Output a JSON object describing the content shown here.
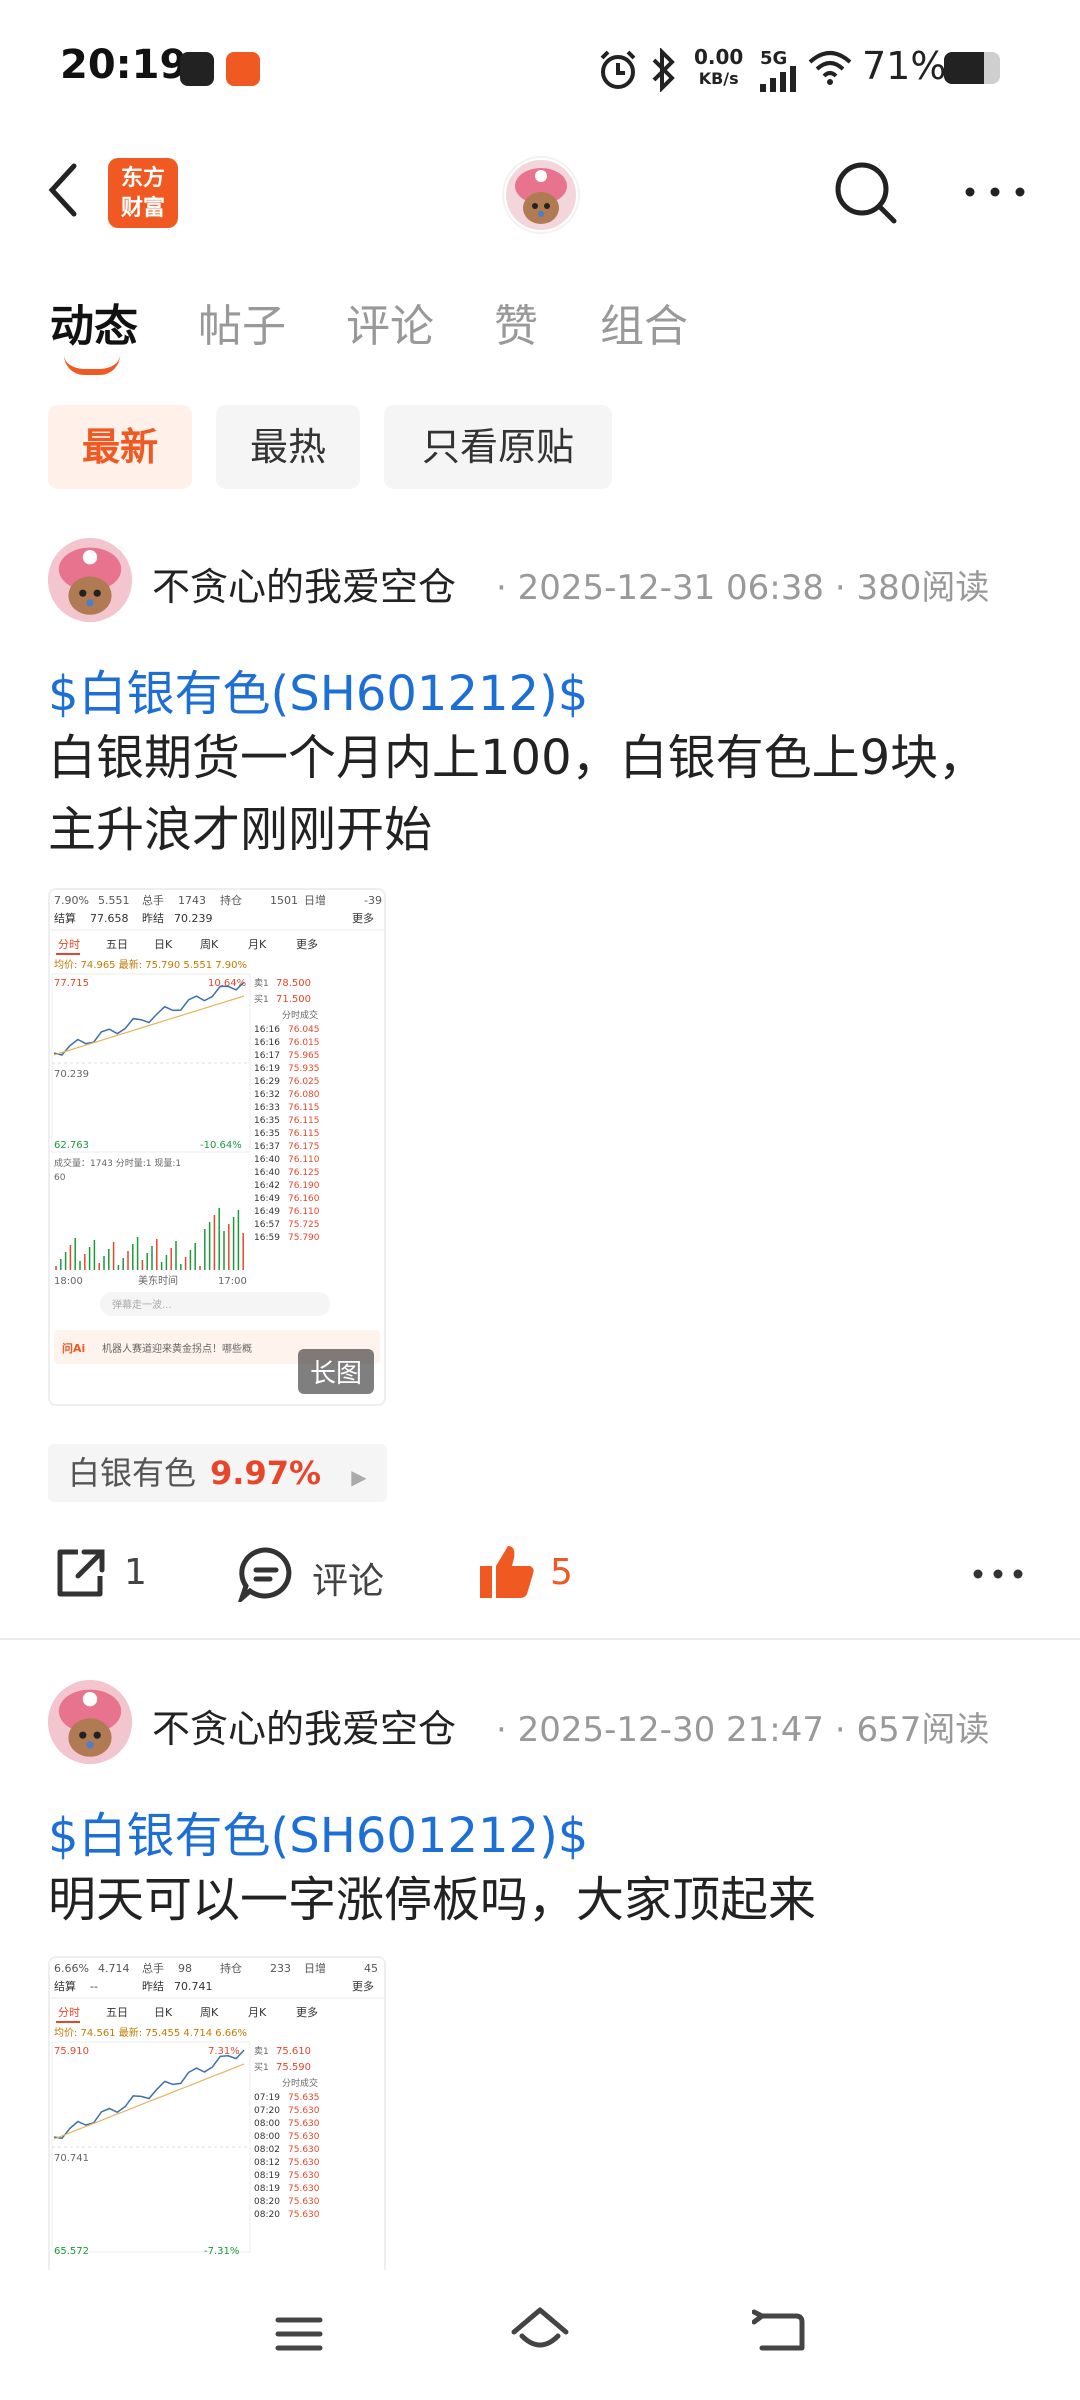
{
  "status_bar": {
    "time": "20:19",
    "net_speed_value": "0.00",
    "net_speed_unit": "KB/s",
    "network": "5G",
    "battery": "71%",
    "icons": [
      "alarm-icon",
      "bluetooth-icon",
      "wifi-icon",
      "battery-icon"
    ]
  },
  "header": {
    "logo_text": [
      "东方",
      "财富"
    ],
    "icons": [
      "back-icon",
      "search-icon",
      "more-icon"
    ]
  },
  "tabs": [
    {
      "label": "动态",
      "active": true
    },
    {
      "label": "帖子",
      "active": false
    },
    {
      "label": "评论",
      "active": false
    },
    {
      "label": "赞",
      "active": false
    },
    {
      "label": "组合",
      "active": false
    }
  ],
  "filters": [
    {
      "label": "最新",
      "active": true
    },
    {
      "label": "最热",
      "active": false
    },
    {
      "label": "只看原贴",
      "active": false
    }
  ],
  "posts": [
    {
      "author": "不贪心的我爱空仓",
      "time": "2025-12-31 06:38",
      "reads": "380阅读",
      "stock_link": "$白银有色(SH601212)$",
      "text": "白银期货一个月内上100，白银有色上9块，主升浪才刚刚开始",
      "image_badge": "长图",
      "thumb": {
        "top_row": [
          "7.90%",
          "5.551",
          "总手",
          "1743",
          "持仓",
          "1501",
          "日增",
          "-39"
        ],
        "second_row": [
          "结算",
          "77.658",
          "昨结",
          "70.239",
          "更多"
        ],
        "tabs": [
          "分时",
          "五日",
          "日K",
          "周K",
          "月K",
          "更多"
        ],
        "avg_line": "均价: 74.965  最新: 75.790  5.551  7.90%",
        "price_high": "77.715",
        "price_mid": "70.239",
        "price_low": "62.763",
        "pct_high": "10.64%",
        "pct_low": "-10.64%",
        "sell1": "78.500",
        "buy1": "71.500",
        "ticks_title": "分时成交",
        "ticks": [
          [
            "16:16",
            "76.045"
          ],
          [
            "16:16",
            "76.015"
          ],
          [
            "16:17",
            "75.965"
          ],
          [
            "16:19",
            "75.935"
          ],
          [
            "16:29",
            "76.025"
          ],
          [
            "16:32",
            "76.080"
          ],
          [
            "16:33",
            "76.115"
          ],
          [
            "16:35",
            "76.115"
          ],
          [
            "16:35",
            "76.115"
          ],
          [
            "16:37",
            "76.175"
          ],
          [
            "16:40",
            "76.110"
          ],
          [
            "16:40",
            "76.125"
          ],
          [
            "16:42",
            "76.190"
          ],
          [
            "16:49",
            "76.160"
          ],
          [
            "16:49",
            "76.110"
          ],
          [
            "16:57",
            "75.725"
          ],
          [
            "16:59",
            "75.790"
          ]
        ],
        "volume_label": "成交量：1743   分时量:1   现量:1",
        "volume_max": "60",
        "time_start": "18:00",
        "time_mid": "美东时间",
        "time_end": "17:00",
        "comment_placeholder": "弹幕走一波...",
        "ai_text": "机器人赛道迎来黄金拐点！哪些概"
      },
      "stock_tag": {
        "name": "白银有色",
        "pct": "9.97%"
      },
      "actions": {
        "share_count": "1",
        "comment_label": "评论",
        "like_count": "5"
      }
    },
    {
      "author": "不贪心的我爱空仓",
      "time": "2025-12-30 21:47",
      "reads": "657阅读",
      "stock_link": "$白银有色(SH601212)$",
      "text": "明天可以一字涨停板吗，大家顶起来",
      "thumb": {
        "top_row": [
          "6.66%",
          "4.714",
          "总手",
          "98",
          "持仓",
          "233",
          "日增",
          "45"
        ],
        "second_row": [
          "结算",
          "--",
          "昨结",
          "70.741",
          "更多"
        ],
        "tabs": [
          "分时",
          "五日",
          "日K",
          "周K",
          "月K",
          "更多"
        ],
        "avg_line": "均价: 74.561  最新: 75.455  4.714  6.66%",
        "price_high": "75.910",
        "price_mid": "70.741",
        "price_low": "65.572",
        "pct_high": "7.31%",
        "pct_low": "-7.31%",
        "sell1": "75.610",
        "buy1": "75.590",
        "ticks_title": "分时成交",
        "ticks": [
          [
            "07:19",
            "75.635"
          ],
          [
            "07:20",
            "75.630"
          ],
          [
            "08:00",
            "75.630"
          ],
          [
            "08:00",
            "75.630"
          ],
          [
            "08:02",
            "75.630"
          ],
          [
            "08:12",
            "75.630"
          ],
          [
            "08:19",
            "75.630"
          ],
          [
            "08:19",
            "75.630"
          ],
          [
            "08:20",
            "75.630"
          ],
          [
            "08:20",
            "75.630"
          ]
        ]
      }
    }
  ],
  "nav_bar": {
    "icons": [
      "menu-icon",
      "home-icon",
      "back-nav-icon"
    ]
  }
}
